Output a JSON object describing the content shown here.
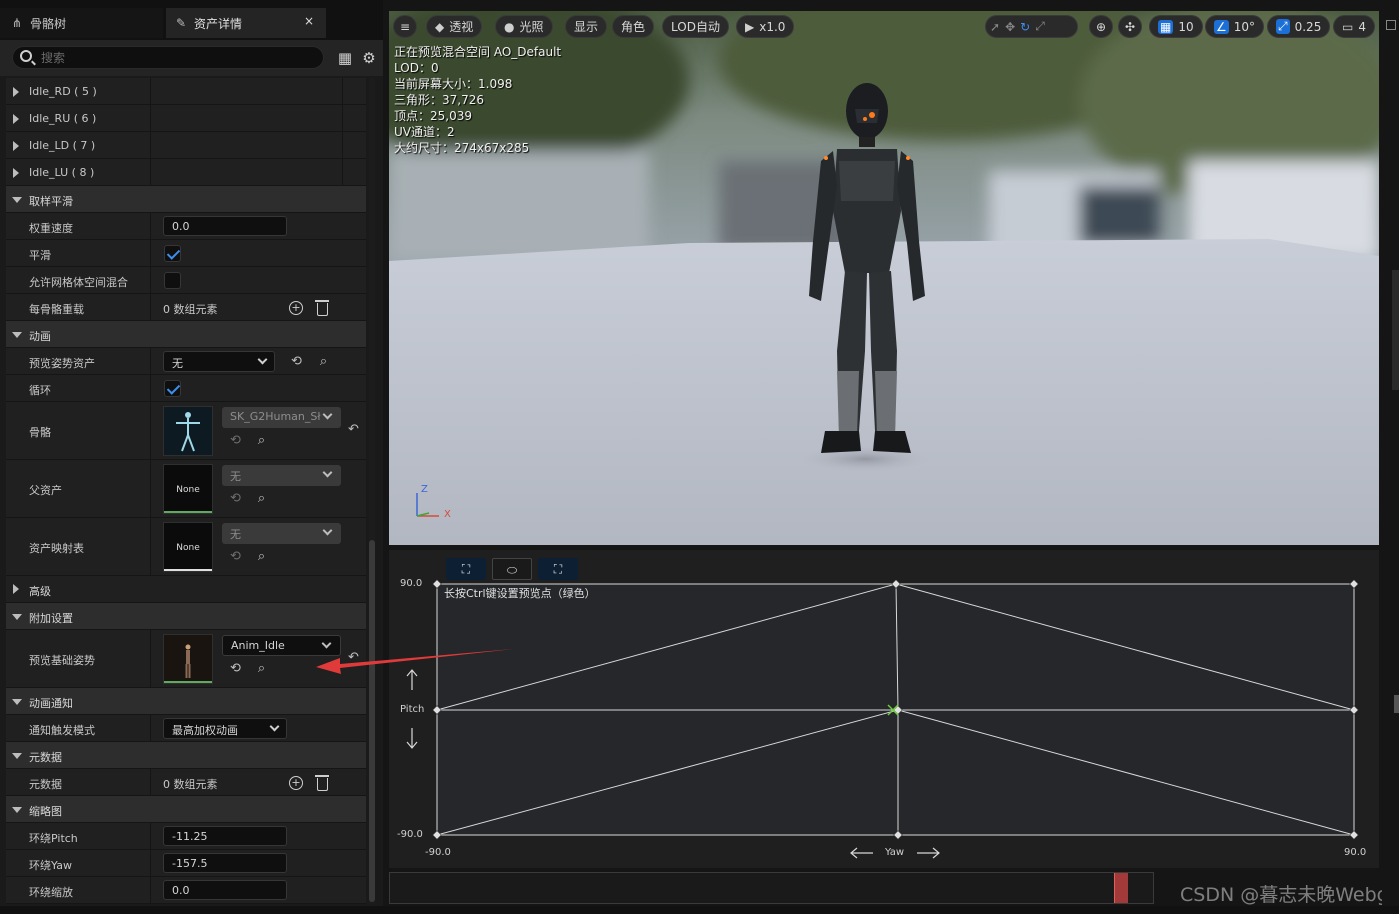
{
  "tabs": [
    {
      "label": "骨骼树",
      "icon": "skeleton-tree-icon"
    },
    {
      "label": "资产详情",
      "icon": "asset-details-icon",
      "close": "×"
    }
  ],
  "search": {
    "placeholder": "搜索"
  },
  "details": {
    "idle_rows": [
      "Idle_RD ( 5 )",
      "Idle_RU ( 6 )",
      "Idle_LD ( 7 )",
      "Idle_LU ( 8 )"
    ],
    "sampling": {
      "header": "取样平滑",
      "weight_speed_label": "权重速度",
      "weight_speed_value": "0.0",
      "smooth_label": "平滑",
      "mesh_space_label": "允许网格体空间混合",
      "per_bone_label": "每骨骼重载",
      "per_bone_value": "0 数组元素"
    },
    "animation": {
      "header": "动画",
      "preview_pose_label": "预览姿势资产",
      "preview_pose_value": "无",
      "loop_label": "循环",
      "skeleton_label": "骨骼",
      "skeleton_value": "SK_G2Human_Sł",
      "parent_label": "父资产",
      "parent_value": "无",
      "parent_thumb": "None",
      "mapping_label": "资产映射表",
      "mapping_value": "无",
      "mapping_thumb": "None"
    },
    "advanced": {
      "header": "高级"
    },
    "additive": {
      "header": "附加设置",
      "base_pose_label": "预览基础姿势",
      "base_pose_value": "Anim_Idle"
    },
    "notify": {
      "header": "动画通知",
      "trigger_label": "通知触发模式",
      "trigger_value": "最高加权动画"
    },
    "metadata": {
      "header": "元数据",
      "label": "元数据",
      "value": "0 数组元素"
    },
    "thumbnail": {
      "header": "缩略图",
      "pitch_label": "环绕Pitch",
      "pitch_value": "-11.25",
      "yaw_label": "环绕Yaw",
      "yaw_value": "-157.5",
      "zoom_label": "环绕缩放",
      "zoom_value": "0.0"
    }
  },
  "viewport": {
    "toolbar": {
      "perspective": "透视",
      "lighting": "光照",
      "show": "显示",
      "character": "角色",
      "lod": "LOD自动",
      "speed": "x1.0",
      "grid": "10",
      "angle": "10°",
      "scale": "0.25",
      "camera": "4"
    },
    "info": [
      "正在预览混合空间 AO_Default",
      "LOD：0",
      "当前屏幕大小：1.098",
      "三角形：37,726",
      "顶点：25,039",
      "UV通道：2",
      "大约尺寸：274x67x285"
    ],
    "axis": {
      "z": "Z",
      "x": "X"
    }
  },
  "blendspace": {
    "hint": "长按Ctrl键设置预览点（绿色）",
    "y_max": "90.0",
    "y_min": "-90.0",
    "y_name": "Pitch",
    "x_min": "-90.0",
    "x_max": "90.0",
    "x_name": "Yaw"
  },
  "watermark": "CSDN @暮志未晚Webgl",
  "colors": {
    "accent": "#1b6fd6",
    "checkbox": "#3d8eef",
    "arrow": "#e03a3a",
    "preview_point": "#6fcf3f",
    "timeline_marker": "#a33a3a"
  }
}
